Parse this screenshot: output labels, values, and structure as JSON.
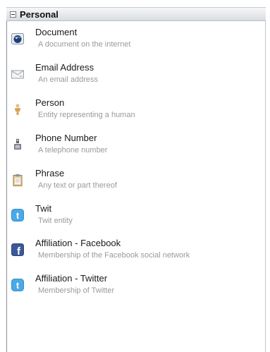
{
  "group": {
    "title": "Personal"
  },
  "items": [
    {
      "title": "Document",
      "description": "A document on the internet",
      "icon": "globe-document-icon"
    },
    {
      "title": "Email Address",
      "description": "An email address",
      "icon": "email-envelope-icon"
    },
    {
      "title": "Person",
      "description": "Entity representing a human",
      "icon": "person-icon"
    },
    {
      "title": "Phone Number",
      "description": "A telephone number",
      "icon": "telephone-icon"
    },
    {
      "title": "Phrase",
      "description": "Any text or part thereof",
      "icon": "clipboard-phrase-icon"
    },
    {
      "title": "Twit",
      "description": "Twit entity",
      "icon": "twitter-icon"
    },
    {
      "title": "Affiliation - Facebook",
      "description": "Membership of the Facebook social network",
      "icon": "facebook-icon"
    },
    {
      "title": "Affiliation - Twitter",
      "description": "Membership of Twitter",
      "icon": "twitter-icon"
    }
  ],
  "colors": {
    "twitter": "#4aa9e6",
    "facebook": "#3b5998"
  }
}
